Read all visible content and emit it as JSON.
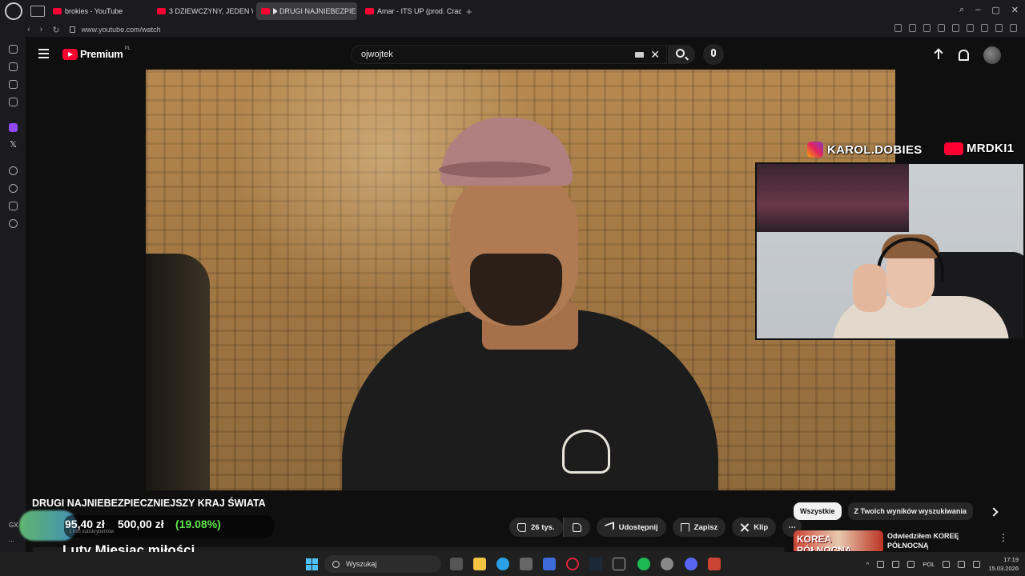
{
  "browser": {
    "tabs": [
      {
        "label": "brokies - YouTube",
        "active": false
      },
      {
        "label": "3 DZIEWCZYNY, JEDEN W",
        "active": false
      },
      {
        "label": "DRUGI NAJNIEBEZPIE",
        "active": true
      },
      {
        "label": "Amar - ITS UP (prod. Crac",
        "active": false
      }
    ],
    "url": "www.youtube.com/watch"
  },
  "youtube": {
    "logo_text": "Premium",
    "region": "PL",
    "search_query": "ojwojtek"
  },
  "overlay": {
    "instagram_handle": "KAROL.DOBIES",
    "youtube_handle": "MRDKI1",
    "stock_price": "95,40 zł",
    "stock_target": "500,00 zł",
    "stock_pct": "(19.08%)",
    "subs_label": "1 mln subskrybentów",
    "bottom_text": "Luty Miesiąc miłości"
  },
  "video": {
    "title": "DRUGI NAJNIEBEZPIECZNIEJSZY KRAJ ŚWIATA",
    "likes": "26 tys.",
    "share_label": "Udostępnij",
    "save_label": "Zapisz",
    "clip_label": "Klip"
  },
  "sidebar_right": {
    "chips": [
      "Wszystkie",
      "Z Twoich wyników wyszukiwania"
    ],
    "rec_thumb_text": "KOREA PÓŁNOCNA",
    "rec_title": "Odwiedziłem KOREĘ PÓŁNOCNĄ"
  },
  "leftmenu": {
    "gx_label": "GX",
    "more": "..."
  },
  "taskbar": {
    "search_placeholder": "Wyszukaj",
    "lang": "POL",
    "time": "17:19",
    "date": "15.03.2026"
  },
  "colors": {
    "youtube_red": "#ff0033",
    "accent_green": "#5fe34b",
    "twitch_purple": "#9146ff"
  }
}
